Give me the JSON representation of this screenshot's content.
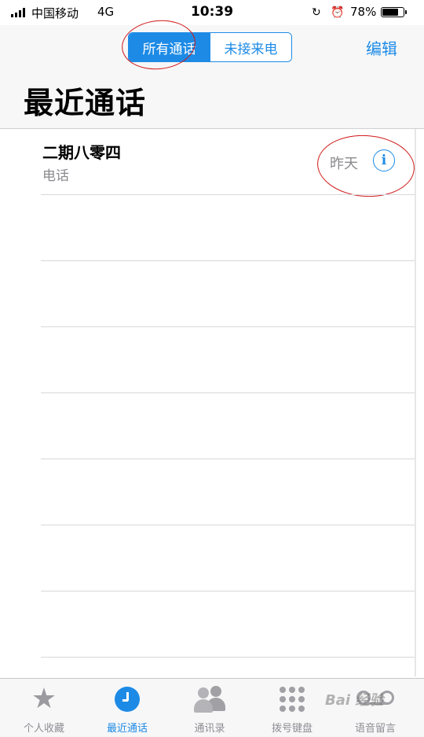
{
  "status_bar": {
    "carrier": "中国移动",
    "network": "4G",
    "time": "10:39",
    "battery_percent": "78%",
    "battery_level": 0.78
  },
  "header": {
    "segments": [
      "所有通话",
      "未接来电"
    ],
    "selected_segment": 0,
    "edit_label": "编辑",
    "title": "最近通话"
  },
  "calls": [
    {
      "name": "二期八零四",
      "type": "电话",
      "date": "昨天"
    }
  ],
  "tabs": [
    {
      "label": "个人收藏",
      "icon": "star-icon"
    },
    {
      "label": "最近通话",
      "icon": "clock-icon",
      "active": true
    },
    {
      "label": "通讯录",
      "icon": "contacts-icon"
    },
    {
      "label": "拨号键盘",
      "icon": "keypad-icon"
    },
    {
      "label": "语音留言",
      "icon": "voicemail-icon"
    }
  ],
  "watermark": "Bai 经验",
  "colors": {
    "accent": "#1d8be6",
    "annotation": "#d01818"
  }
}
